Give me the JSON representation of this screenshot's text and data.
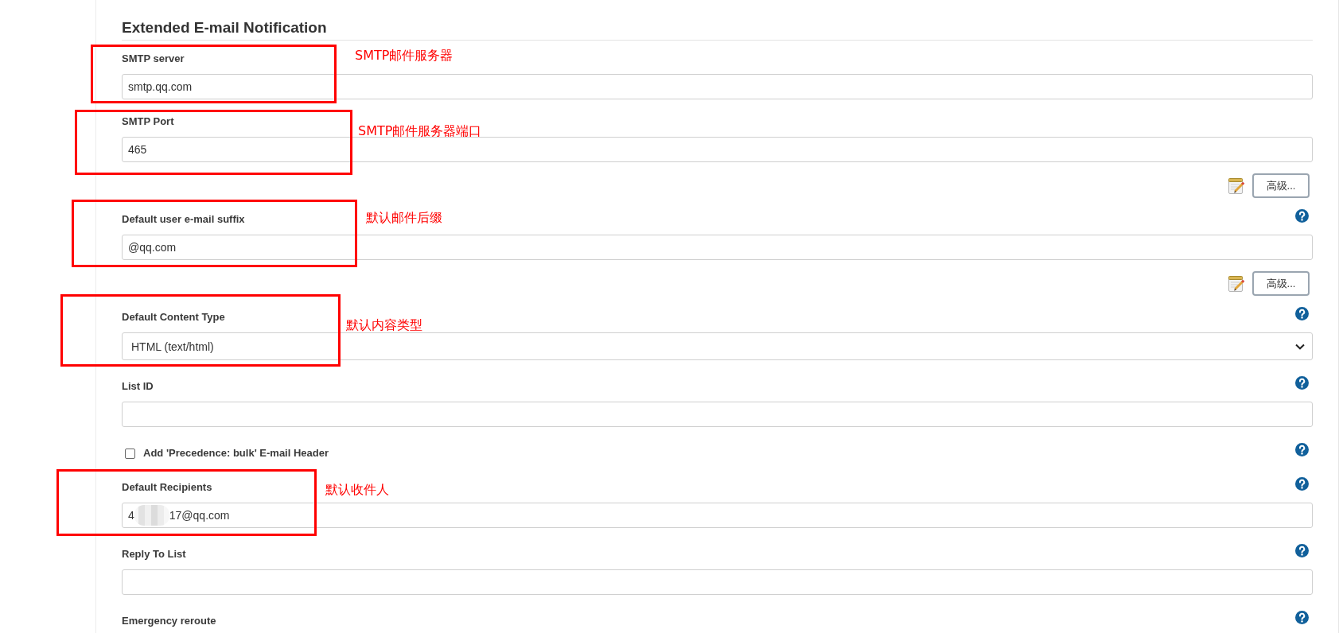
{
  "section": {
    "title": "Extended E-mail Notification"
  },
  "rows": [
    {
      "kind": "text",
      "label": "SMTP server",
      "value": "smtp.qq.com",
      "help": false,
      "annotation": "SMTP邮件服务器"
    },
    {
      "kind": "text",
      "label": "SMTP Port",
      "value": "465",
      "help": false,
      "annotation": "SMTP邮件服务器端口"
    },
    {
      "kind": "advanced",
      "button": "高级..."
    },
    {
      "kind": "text",
      "label": "Default user e-mail suffix",
      "value": "@qq.com",
      "help": true,
      "annotation": "默认邮件后缀"
    },
    {
      "kind": "advanced",
      "button": "高级..."
    },
    {
      "kind": "select",
      "label": "Default Content Type",
      "value": "HTML (text/html)",
      "help": true,
      "annotation": "默认内容类型"
    },
    {
      "kind": "text",
      "label": "List ID",
      "help": true
    },
    {
      "kind": "checkbox",
      "label": "Add 'Precedence: bulk' E-mail Header",
      "checked": false,
      "help": true
    },
    {
      "kind": "masked",
      "label": "Default Recipients",
      "value_start": "4",
      "value_end": "17@qq.com",
      "help": true,
      "annotation": "默认收件人"
    },
    {
      "kind": "text",
      "label": "Reply To List",
      "help": true
    },
    {
      "kind": "label",
      "label": "Emergency reroute",
      "help": true
    }
  ]
}
